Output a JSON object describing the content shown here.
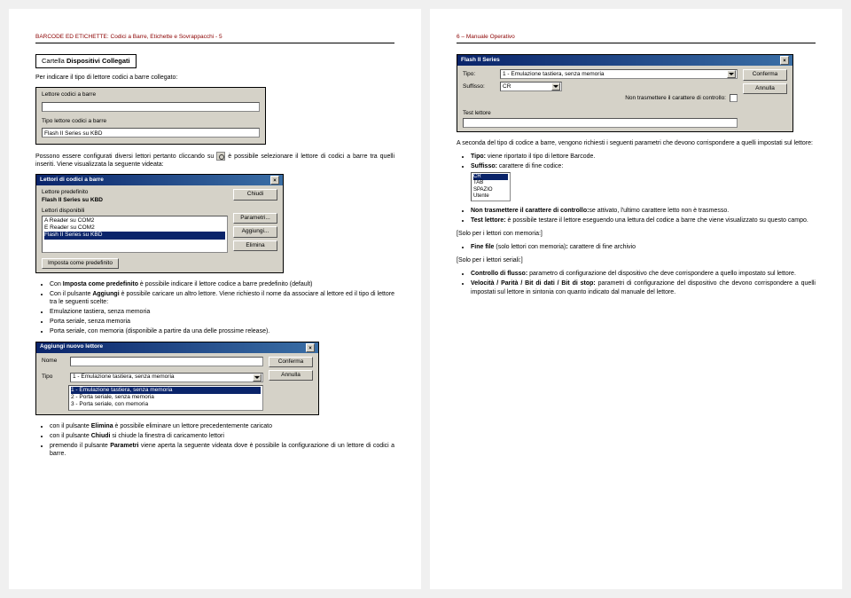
{
  "leftPage": {
    "header": "BARCODE ED ETICHETTE: Codici a Barre, Etichette e Sovrappacchi  -   5",
    "sectionTitle": "Cartella Dispositivi Collegati",
    "intro": "Per indicare il tipo di lettore codici a barre collegato:",
    "win1": {
      "label1": "Lettore codici a barre",
      "label2": "Tipo lettore codici a barre",
      "value2": "Flash II Series su KBD"
    },
    "para1a": "Possono essere configurati diversi lettori pertanto cliccando su ",
    "para1b": " è possibile selezionare il lettore di codici a barre tra quelli inseriti. Viene visualizzata la seguente videata:",
    "win2": {
      "title": "Lettori di codici a barre",
      "lblPredef": "Lettore predefinito",
      "valPredef": "Flash II Series su KBD",
      "lblDisp": "Lettori disponibili",
      "list": [
        "A Reader su COM2",
        "E Reader su COM2",
        "Flash II Series su KBD"
      ],
      "btnChiudi": "Chiudi",
      "btnParam": "Parametri...",
      "btnAgg": "Aggiungi...",
      "btnElim": "Elimina",
      "btnImposta": "Imposta come predefinito"
    },
    "bullets1": [
      "Con <b>Imposta come predefinito</b> è possibile indicare il lettore codice a barre predefinito (default)",
      "Con il pulsante <b>Aggiungi</b> è possibile caricare un altro lettore. Viene richiesto il nome da associare al lettore ed il tipo di lettore tra le seguenti scelte:",
      "Emulazione tastiera, senza memoria",
      "Porta seriale, senza memoria",
      "Porta seriale, con memoria (disponibile a partire da una delle prossime release)."
    ],
    "win3": {
      "title": "Aggiungi nuovo lettore",
      "lblNome": "Nome",
      "lblTipo": "Tipo",
      "comboVal": "1 - Emulazione tastiera, senza memoria",
      "dropdown": [
        "1 - Emulazione tastiera, senza memoria",
        "2 - Porta seriale, senza memoria",
        "3 - Porta seriale, con memoria"
      ],
      "btnConf": "Conferma",
      "btnAnn": "Annulla"
    },
    "bullets2": [
      "con il pulsante <b>Elimina</b> è possibile eliminare un lettore precedentemente caricato",
      "con il pulsante <b>Chiudi</b> si chiude la finestra di caricamento lettori",
      "premendo il pulsante <b>Parametri</b> viene aperta la seguente videata dove è possibile la configurazione di un lettore di codici a barre."
    ]
  },
  "rightPage": {
    "header": "6  –  Manuale Operativo",
    "win4": {
      "title": "Flash II Series",
      "lblTipo": "Tipo:",
      "valTipo": "1 - Emulazione tastiera, senza memoria",
      "lblSuff": "Suffisso:",
      "valSuff": "CR",
      "lblNonTras": "Non trasmettere il carattere di controllo:",
      "lblTest": "Test lettore",
      "btnConf": "Conferma",
      "btnAnn": "Annulla"
    },
    "para2": "A seconda del tipo di codice a barre, vengono richiesti i seguenti parametri che devono corrispondere a quelli impostati sul lettore:",
    "bullets3a": "<b>Tipo:</b> viene riportato il tipo di lettore Barcode.",
    "bullets3b": "<b>Suffisso:</b> carattere di fine codice:",
    "miniList": [
      "CR",
      "TAB",
      "SPAZIO",
      "Utente"
    ],
    "bullets4": [
      "<b>Non trasmettere il carattere di controllo:</b>se attivato, l'ultimo carattere letto non è trasmesso.",
      "<b>Test lettore:</b> è possibile testare il lettore eseguendo una lettura del codice a barre che viene visualizzato su questo campo."
    ],
    "memHeader": "[Solo per i lettori con memoria:]",
    "bullets5": [
      "<b>Fine file</b> (solo lettori con memoria)<b>:</b> carattere di fine archivio"
    ],
    "serHeader": "[Solo per i lettori seriali:]",
    "bullets6": [
      "<b>Controllo di flusso:</b> parametro di configurazione del dispositivo che deve corrispondere a quello impostato sul lettore.",
      "<b>Velocità / Parità / Bit di dati / Bit di stop:</b> parametri di configurazione del dispositivo che devono corrispondere a quelli impostati sul lettore in sintonia con quanto indicato dal manuale del lettore."
    ]
  }
}
